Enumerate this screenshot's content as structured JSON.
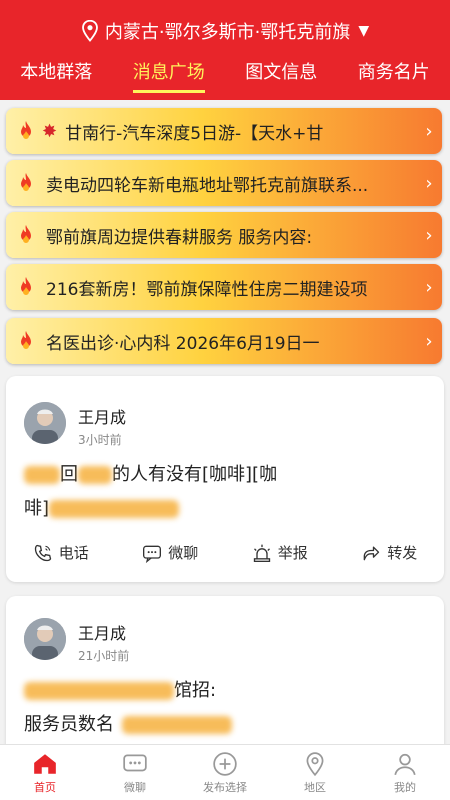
{
  "header": {
    "location": "内蒙古·鄂尔多斯市·鄂托克前旗",
    "location_caret": "▼",
    "tabs": [
      {
        "label": "本地群落"
      },
      {
        "label": "消息广场"
      },
      {
        "label": "图文信息"
      },
      {
        "label": "商务名片"
      }
    ],
    "active_tab": "消息广场",
    "bg_color": "#e8252a",
    "active_color": "#fff35c"
  },
  "banners": [
    {
      "text": "甘南行-汽车深度5日游-【天水+甘",
      "spark": "✸"
    },
    {
      "text": "卖电动四轮车新电瓶地址鄂托克前旗联系..."
    },
    {
      "text": "鄂前旗周边提供春耕服务 服务内容:"
    },
    {
      "text": "216套新房！鄂前旗保障性住房二期建设项"
    },
    {
      "text": "名医出诊·心内科 2026年6月19日一"
    }
  ],
  "banner_chevron": "›",
  "posts": [
    {
      "username": "王月成",
      "time": "3小时前",
      "line1_mid": "回",
      "line1_end": "的人有没有[咖啡][咖",
      "line2": "啡]",
      "actions": {
        "call": "电话",
        "chat": "微聊",
        "report": "举报",
        "share": "转发"
      }
    },
    {
      "username": "王月成",
      "time": "21小时前",
      "line1_end": "馆招:",
      "line2": "服务员数名"
    }
  ],
  "bottom_nav": [
    {
      "label": "首页",
      "icon": "home-icon"
    },
    {
      "label": "微聊",
      "icon": "chat-icon"
    },
    {
      "label": "发布选择",
      "icon": "plus-circle-icon"
    },
    {
      "label": "地区",
      "icon": "map-pin-icon"
    },
    {
      "label": "我的",
      "icon": "user-icon"
    }
  ]
}
